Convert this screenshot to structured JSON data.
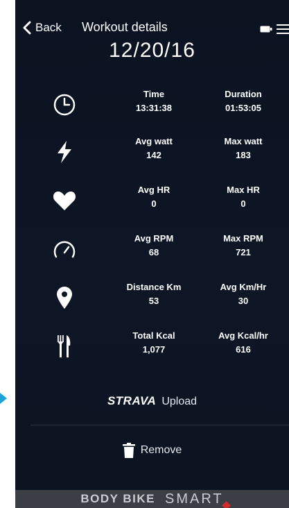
{
  "header": {
    "back_label": "Back",
    "title": "Workout details",
    "date": "12/20/16"
  },
  "stats": [
    {
      "icon": "clock-icon",
      "left_label": "Time",
      "left_value": "13:31:38",
      "right_label": "Duration",
      "right_value": "01:53:05"
    },
    {
      "icon": "lightning-icon",
      "left_label": "Avg watt",
      "left_value": "142",
      "right_label": "Max watt",
      "right_value": "183"
    },
    {
      "icon": "heart-icon",
      "left_label": "Avg HR",
      "left_value": "0",
      "right_label": "Max HR",
      "right_value": "0"
    },
    {
      "icon": "speedometer-icon",
      "left_label": "Avg RPM",
      "left_value": "68",
      "right_label": "Max RPM",
      "right_value": "721"
    },
    {
      "icon": "location-pin-icon",
      "left_label": "Distance Km",
      "left_value": "53",
      "right_label": "Avg Km/Hr",
      "right_value": "30"
    },
    {
      "icon": "fork-knife-icon",
      "left_label": "Total Kcal",
      "left_value": "1,077",
      "right_label": "Avg Kcal/hr",
      "right_value": "616"
    }
  ],
  "actions": {
    "strava_logo": "STRAVA",
    "upload_label": "Upload",
    "remove_label": "Remove"
  },
  "footer": {
    "brand": "BODY BIKE",
    "smart": "SMART"
  },
  "colors": {
    "background": "#0e1626",
    "text": "#ffffff",
    "accent_arrow": "#1fa2d6",
    "footer_bg": "#3b3f45",
    "footer_accent": "#d42a2a"
  }
}
